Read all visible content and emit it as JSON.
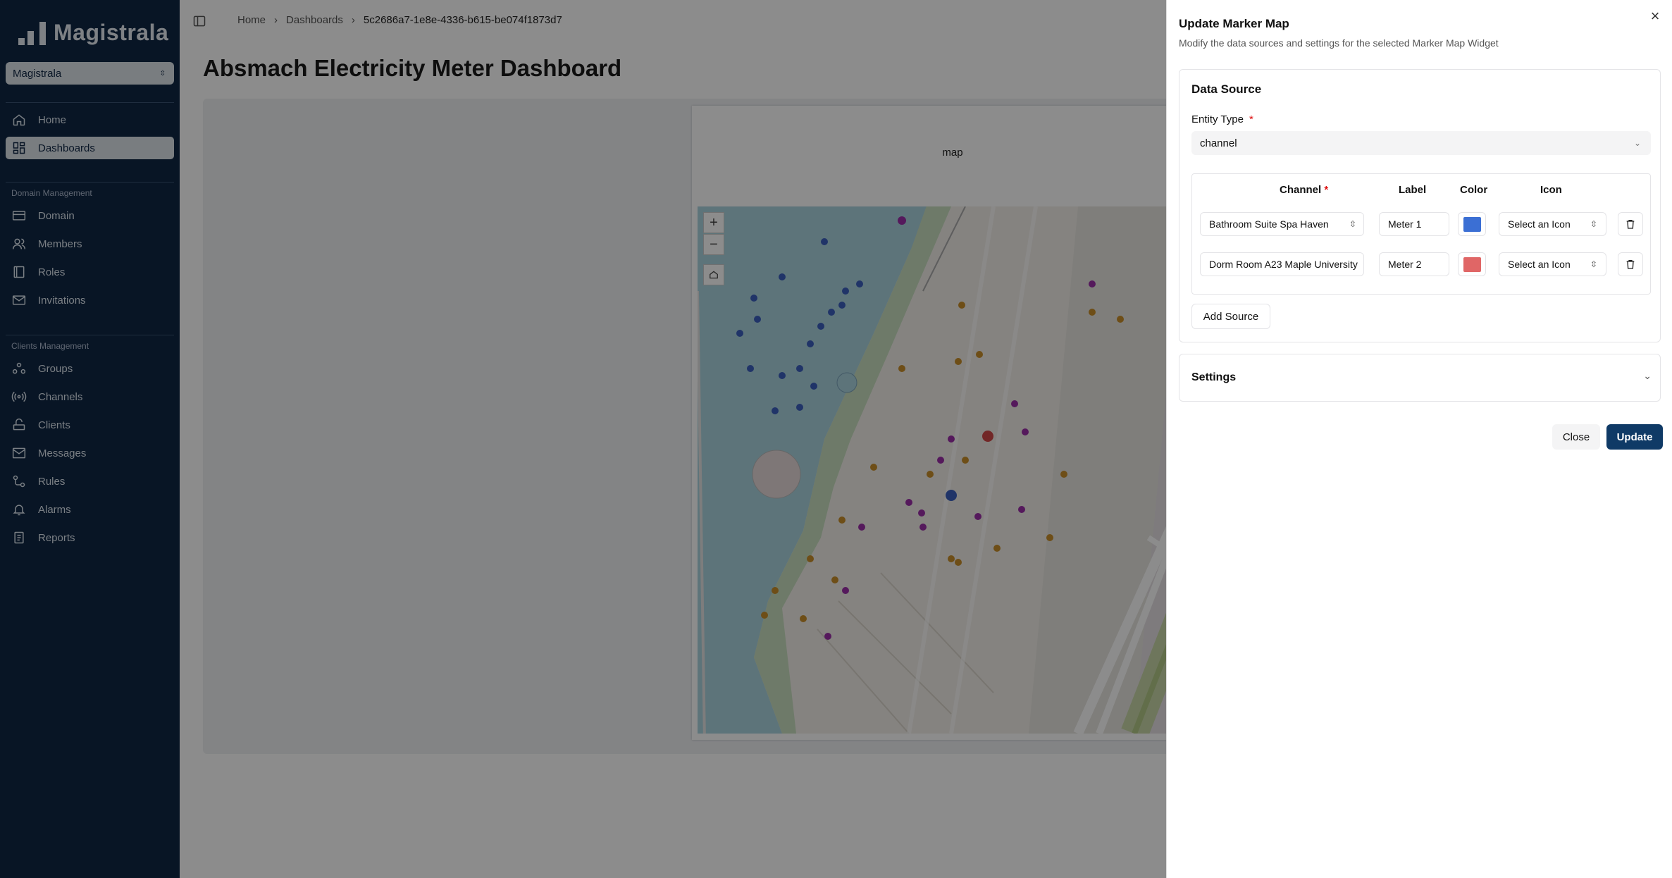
{
  "app": {
    "name": "Magistrala"
  },
  "domain_select": {
    "value": "Magistrala"
  },
  "sidebar": {
    "main_items": [
      {
        "label": "Home",
        "icon": "home-icon"
      },
      {
        "label": "Dashboards",
        "icon": "dashboard-icon",
        "active": true
      }
    ],
    "domain_section": "Domain Management",
    "domain_items": [
      {
        "label": "Domain",
        "icon": "domain-icon"
      },
      {
        "label": "Members",
        "icon": "members-icon"
      },
      {
        "label": "Roles",
        "icon": "roles-icon"
      },
      {
        "label": "Invitations",
        "icon": "mail-icon"
      }
    ],
    "clients_section": "Clients Management",
    "clients_items": [
      {
        "label": "Groups",
        "icon": "groups-icon"
      },
      {
        "label": "Channels",
        "icon": "channels-icon"
      },
      {
        "label": "Clients",
        "icon": "clients-icon"
      },
      {
        "label": "Messages",
        "icon": "messages-icon"
      },
      {
        "label": "Rules",
        "icon": "rules-icon"
      },
      {
        "label": "Alarms",
        "icon": "alarm-icon"
      },
      {
        "label": "Reports",
        "icon": "reports-icon"
      }
    ]
  },
  "breadcrumb": [
    "Home",
    "Dashboards",
    "5c2686a7-1e8e-4336-b615-be074f1873d7"
  ],
  "page_title": "Absmach Electricity Meter Dashboard",
  "widget": {
    "title": "map"
  },
  "drawer": {
    "title": "Update Marker Map",
    "subtitle": "Modify the data sources and settings for the selected Marker Map Widget",
    "data_source_title": "Data Source",
    "entity_type_label": "Entity Type",
    "entity_type_value": "channel",
    "columns": {
      "channel": "Channel",
      "label": "Label",
      "color": "Color",
      "icon": "Icon"
    },
    "sources": [
      {
        "channel": "Bathroom Suite Spa Haven",
        "label": "Meter 1",
        "color": "#3b6fd4",
        "icon": "Select an Icon"
      },
      {
        "channel": "Dorm Room A23 Maple University",
        "label": "Meter 2",
        "color": "#e06666",
        "icon": "Select an Icon"
      }
    ],
    "add_source_label": "Add Source",
    "settings_title": "Settings",
    "close_label": "Close",
    "update_label": "Update"
  }
}
